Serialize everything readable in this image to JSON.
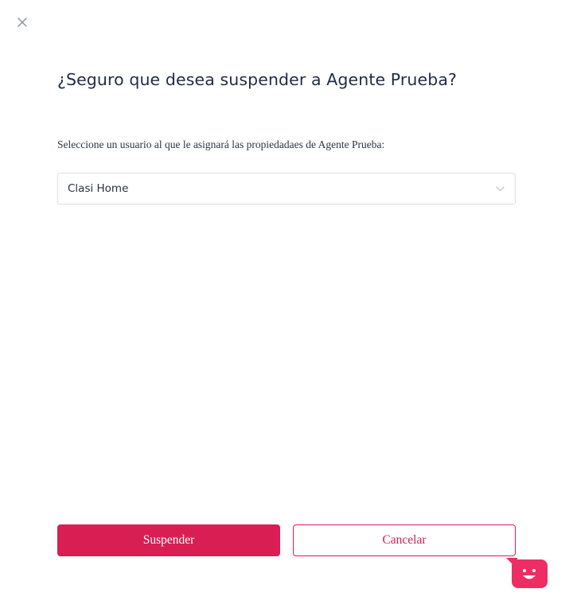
{
  "dialog": {
    "title": "¿Seguro que desea suspender a Agente Prueba?",
    "instruction": "Seleccione un usuario al que le asignará las propiedadaes de Agente Prueba:",
    "select": {
      "value": "Clasi Home"
    },
    "buttons": {
      "suspend_label": "Suspender",
      "cancel_label": "Cancelar"
    }
  },
  "icons": {
    "close": "close-icon",
    "chevron": "chevron-down-icon",
    "chat": "chat-bot-icon"
  },
  "colors": {
    "accent": "#d81e52",
    "title": "#1f2b46",
    "text": "#2b3346",
    "border": "#dcdfe5",
    "close_icon": "#8a8f9a",
    "chat_widget": "#ee2d62"
  }
}
